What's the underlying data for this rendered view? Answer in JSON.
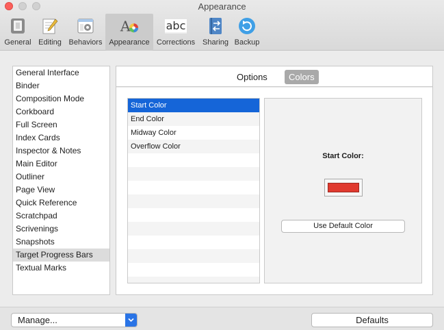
{
  "window": {
    "title": "Appearance"
  },
  "toolbar": {
    "items": [
      {
        "label": "General",
        "icon": "general-icon"
      },
      {
        "label": "Editing",
        "icon": "editing-icon"
      },
      {
        "label": "Behaviors",
        "icon": "behaviors-icon"
      },
      {
        "label": "Appearance",
        "icon": "appearance-icon",
        "selected": true
      },
      {
        "label": "Corrections",
        "icon": "corrections-icon",
        "icon_text": "abc"
      },
      {
        "label": "Sharing",
        "icon": "sharing-icon"
      },
      {
        "label": "Backup",
        "icon": "backup-icon"
      }
    ]
  },
  "sidebar": {
    "items": [
      {
        "label": "General Interface"
      },
      {
        "label": "Binder"
      },
      {
        "label": "Composition Mode"
      },
      {
        "label": "Corkboard"
      },
      {
        "label": "Full Screen"
      },
      {
        "label": "Index Cards"
      },
      {
        "label": "Inspector & Notes"
      },
      {
        "label": "Main Editor"
      },
      {
        "label": "Outliner"
      },
      {
        "label": "Page View"
      },
      {
        "label": "Quick Reference"
      },
      {
        "label": "Scratchpad"
      },
      {
        "label": "Scrivenings"
      },
      {
        "label": "Snapshots"
      },
      {
        "label": "Target Progress Bars",
        "selected": true
      },
      {
        "label": "Textual Marks"
      }
    ]
  },
  "panel": {
    "tabs": [
      {
        "label": "Options"
      },
      {
        "label": "Colors",
        "selected": true
      }
    ],
    "color_items": [
      {
        "label": "Start Color",
        "selected": true
      },
      {
        "label": "End Color"
      },
      {
        "label": "Midway Color"
      },
      {
        "label": "Overflow Color"
      }
    ],
    "detail": {
      "label": "Start Color:",
      "swatch_color": "#e03a2f",
      "default_button": "Use Default Color"
    }
  },
  "bottom": {
    "manage_label": "Manage...",
    "defaults_label": "Defaults"
  },
  "colors": {
    "selection_blue": "#1565d8",
    "close_red": "#fc605c"
  }
}
